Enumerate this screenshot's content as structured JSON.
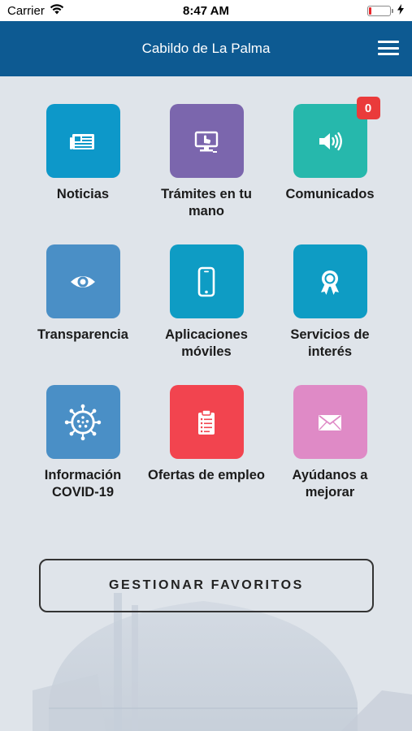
{
  "status_bar": {
    "carrier": "Carrier",
    "time": "8:47 AM",
    "battery_level": 0.12
  },
  "header": {
    "title": "Cabildo de La Palma",
    "menu_icon": "hamburger-menu-icon",
    "background_color": "#0d5a92"
  },
  "tiles": [
    {
      "label": "Noticias",
      "icon": "newspaper-icon",
      "color": "#0d98c9"
    },
    {
      "label": "Trámites en tu mano",
      "icon": "computer-hand-icon",
      "color": "#7b66ad"
    },
    {
      "label": "Comunicados",
      "icon": "speaker-icon",
      "color": "#26b8ac",
      "badge": "0"
    },
    {
      "label": "Transparencia",
      "icon": "eye-icon",
      "color": "#4a8fc6"
    },
    {
      "label": "Aplicaciones móviles",
      "icon": "smartphone-icon",
      "color": "#0e9cc4"
    },
    {
      "label": "Servicios de interés",
      "icon": "award-ribbon-icon",
      "color": "#0e9cc4"
    },
    {
      "label": "Información COVID-19",
      "icon": "virus-icon",
      "color": "#4a8fc6"
    },
    {
      "label": "Ofertas de empleo",
      "icon": "clipboard-icon",
      "color": "#f2444f"
    },
    {
      "label": "Ayúdanos a mejorar",
      "icon": "envelope-icon",
      "color": "#df8ac6"
    }
  ],
  "favorites_button": {
    "label": "GESTIONAR FAVORITOS"
  },
  "badge_color": "#ea3b3b"
}
